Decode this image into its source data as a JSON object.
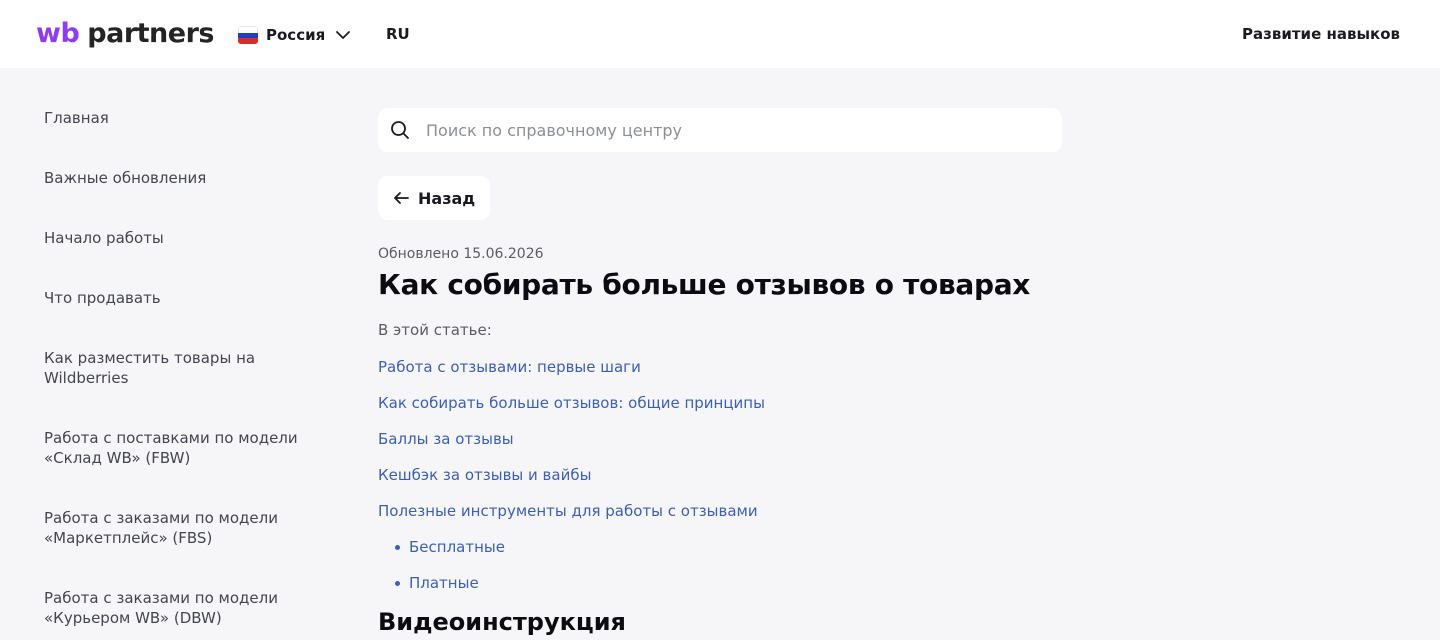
{
  "header": {
    "logo_wb": "wb",
    "logo_partners": "partners",
    "country": "Россия",
    "language": "RU",
    "skills_link": "Развитие навыков"
  },
  "sidebar": {
    "items": [
      "Главная",
      "Важные обновления",
      "Начало работы",
      "Что продавать",
      "Как разместить товары на Wildberries",
      "Работа с поставками по модели «Склад WB» (FBW)",
      "Работа с заказами по модели «Маркетплейс» (FBS)",
      "Работа с заказами по модели «Курьером WB» (DBW)"
    ]
  },
  "search": {
    "placeholder": "Поиск по справочному центру",
    "icon": "search-icon"
  },
  "article": {
    "back_label": "Назад",
    "updated": "Обновлено 15.06.2026",
    "title": "Как собирать больше отзывов о товарах",
    "intro": "В этой статье:",
    "toc": [
      "Работа с отзывами: первые шаги",
      "Как собирать больше отзывов: общие принципы",
      "Баллы за отзывы",
      "Кешбэк за отзывы и вайбы",
      "Полезные инструменты для работы с отзывами"
    ],
    "toc_sub": [
      "Бесплатные",
      "Платные"
    ],
    "video_title": "Видеоинструкция"
  },
  "colors": {
    "brand": "#8f3cf0",
    "link": "#3d5fb0",
    "background": "#f6f6f9"
  }
}
